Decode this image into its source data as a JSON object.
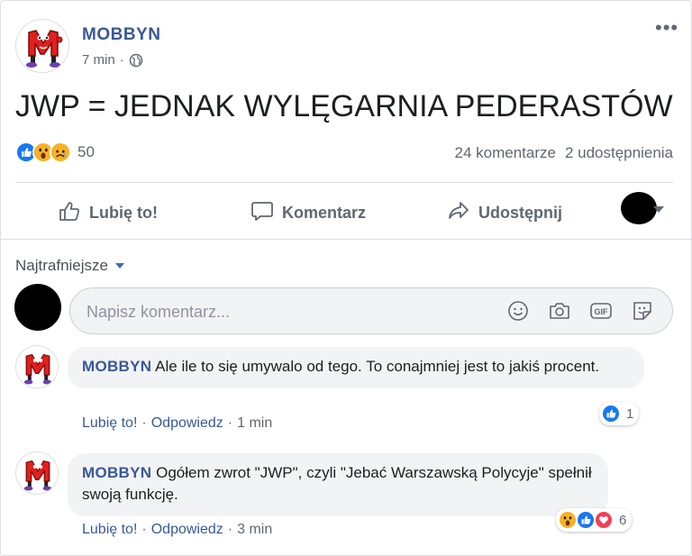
{
  "post": {
    "page_name": "MOBBYN",
    "time": "7 min",
    "separator": "·",
    "text": "JWP = JEDNAK WYLĘGARNIA PEDERASTÓW",
    "reaction_count": "50",
    "comments_count": "24 komentarze",
    "shares_count": "2 udostępnienia",
    "reaction_icons": [
      "like-icon",
      "wow-icon",
      "sad-icon"
    ]
  },
  "actions": {
    "like": "Lubię to!",
    "comment": "Komentarz",
    "share": "Udostępnij"
  },
  "comments_section": {
    "sort_label": "Najtrafniejsze",
    "input_placeholder": "Napisz komentarz...",
    "input_icons": [
      "emoji-icon",
      "camera-icon",
      "gif-icon",
      "sticker-icon"
    ]
  },
  "comments": [
    {
      "author": "MOBBYN",
      "text": "Ale ile to się umywalo od tego. To conajmniej jest to jakiś procent.",
      "like_label": "Lubię to!",
      "reply_label": "Odpowiedz",
      "time": "1 min",
      "reaction_count": "1",
      "reaction_icons": [
        "like-icon"
      ]
    },
    {
      "author": "MOBBYN",
      "text": "Ogółem zwrot \"JWP\", czyli \"Jebać Warszawską Polycyje\" spełnił swoją funkcję.",
      "like_label": "Lubię to!",
      "reply_label": "Odpowiedz",
      "time": "3 min",
      "reaction_count": "6",
      "reaction_icons": [
        "wow-icon",
        "like-icon",
        "love-icon"
      ]
    }
  ],
  "colors": {
    "link_blue": "#385898",
    "like_blue": "#1877f2",
    "love_red": "#f33e58",
    "emoji_yellow": "#f7b125",
    "muted_gray": "#606770"
  }
}
